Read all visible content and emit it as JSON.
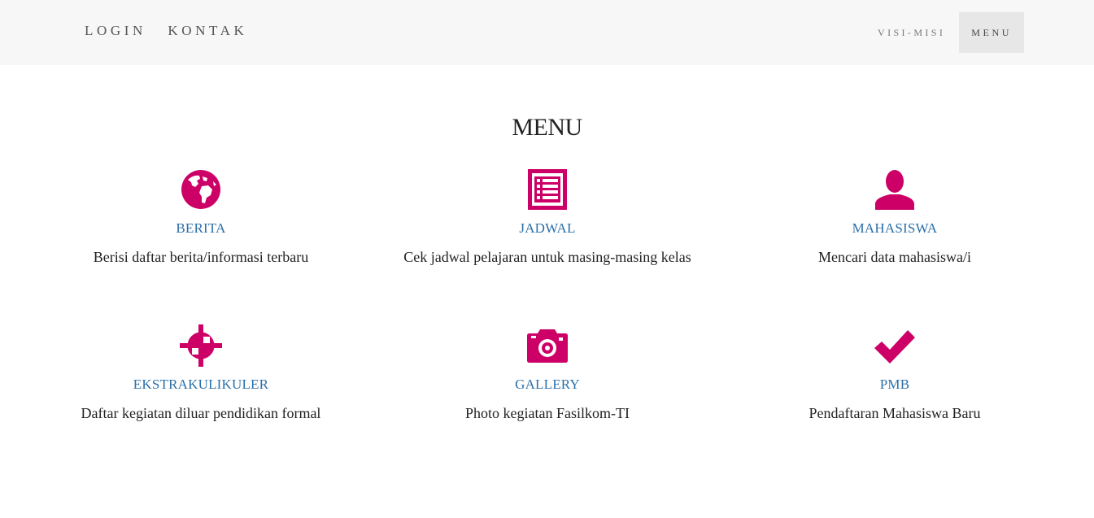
{
  "navbar": {
    "brand": "LOGIN   KONTAK",
    "links": [
      {
        "label": "VISI-MISI"
      },
      {
        "label": "MENU"
      }
    ]
  },
  "section": {
    "title": "MENU"
  },
  "items": [
    {
      "icon": "globe-icon",
      "title": "BERITA",
      "desc": "Berisi daftar berita/informasi terbaru"
    },
    {
      "icon": "list-icon",
      "title": "JADWAL",
      "desc": "Cek jadwal pelajaran untuk masing-masing kelas"
    },
    {
      "icon": "user-icon",
      "title": "MAHASISWA",
      "desc": "Mencari data mahasiswa/i"
    },
    {
      "icon": "crosshair-icon",
      "title": "EKSTRAKULIKULER",
      "desc": "Daftar kegiatan diluar pendidikan formal"
    },
    {
      "icon": "camera-icon",
      "title": "GALLERY",
      "desc": "Photo kegiatan Fasilkom-TI"
    },
    {
      "icon": "checkmark-icon",
      "title": "PMB",
      "desc": "Pendaftaran Mahasiswa Baru"
    }
  ],
  "colors": {
    "accent": "#cc0066",
    "link": "#2b6fa8",
    "navbar_bg": "#f7f7f7",
    "active_bg": "#e7e7e7"
  }
}
